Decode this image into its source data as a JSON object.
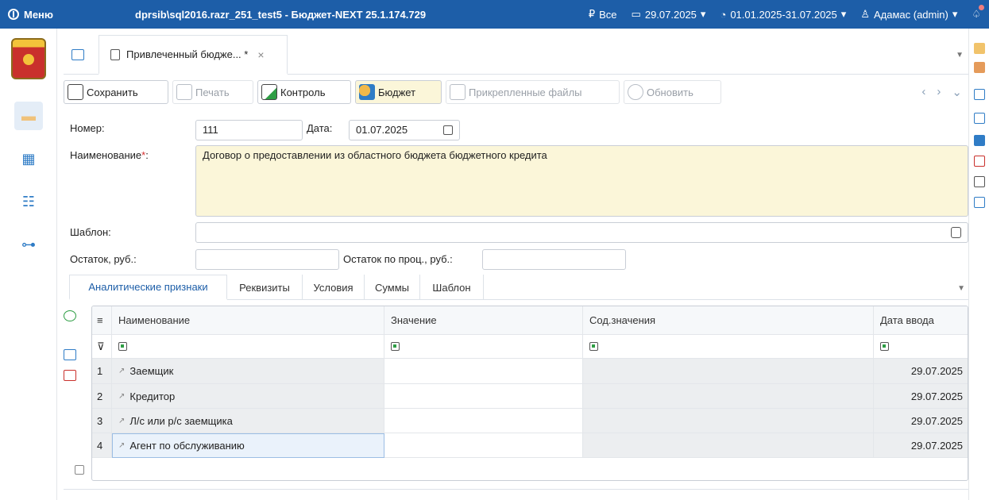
{
  "topbar": {
    "menu_label": "Меню",
    "title": "dprsib\\sql2016.razr_251_test5 - Бюджет-NEXT 25.1.174.729",
    "filter_label": "Все",
    "date_label": "29.07.2025",
    "period_label": "01.01.2025-31.07.2025",
    "user_label": "Адамас (admin)",
    "colors": {
      "bar": "#1d5ea8"
    }
  },
  "document_tab": {
    "label": "Привлеченный бюдже... *",
    "close_symbol": "×"
  },
  "toolbar": {
    "save_label": "Сохранить",
    "print_label": "Печать",
    "control_label": "Контроль",
    "budget_label": "Бюджет",
    "attachments_label": "Прикрепленные файлы",
    "refresh_label": "Обновить"
  },
  "form": {
    "number_label": "Номер:",
    "number_value": "111",
    "date_label": "Дата:",
    "date_value": "01.07.2025",
    "name_label": "Наименование",
    "name_required_mark": "*",
    "name_label_suffix": ":",
    "name_value": "Договор о предоставлении из областного бюджета бюджетного кредита",
    "template_label": "Шаблон:",
    "template_value": "",
    "balance_label": "Остаток, руб.:",
    "balance_value": "",
    "interest_balance_label": "Остаток по проц., руб.:",
    "interest_balance_value": ""
  },
  "lower_tabs": [
    "Аналитические признаки",
    "Реквизиты",
    "Условия",
    "Суммы",
    "Шаблон"
  ],
  "grid": {
    "columns": [
      "Наименование",
      "Значение",
      "Сод.значения",
      "Дата ввода"
    ],
    "rows": [
      {
        "num": "1",
        "name": "Заемщик",
        "value": "",
        "content": "",
        "date": "29.07.2025"
      },
      {
        "num": "2",
        "name": "Кредитор",
        "value": "",
        "content": "",
        "date": "29.07.2025"
      },
      {
        "num": "3",
        "name": "Л/с или р/с заемщика",
        "value": "",
        "content": "",
        "date": "29.07.2025"
      },
      {
        "num": "4",
        "name": "Агент по обслуживанию",
        "value": "",
        "content": "",
        "date": "29.07.2025"
      }
    ]
  }
}
